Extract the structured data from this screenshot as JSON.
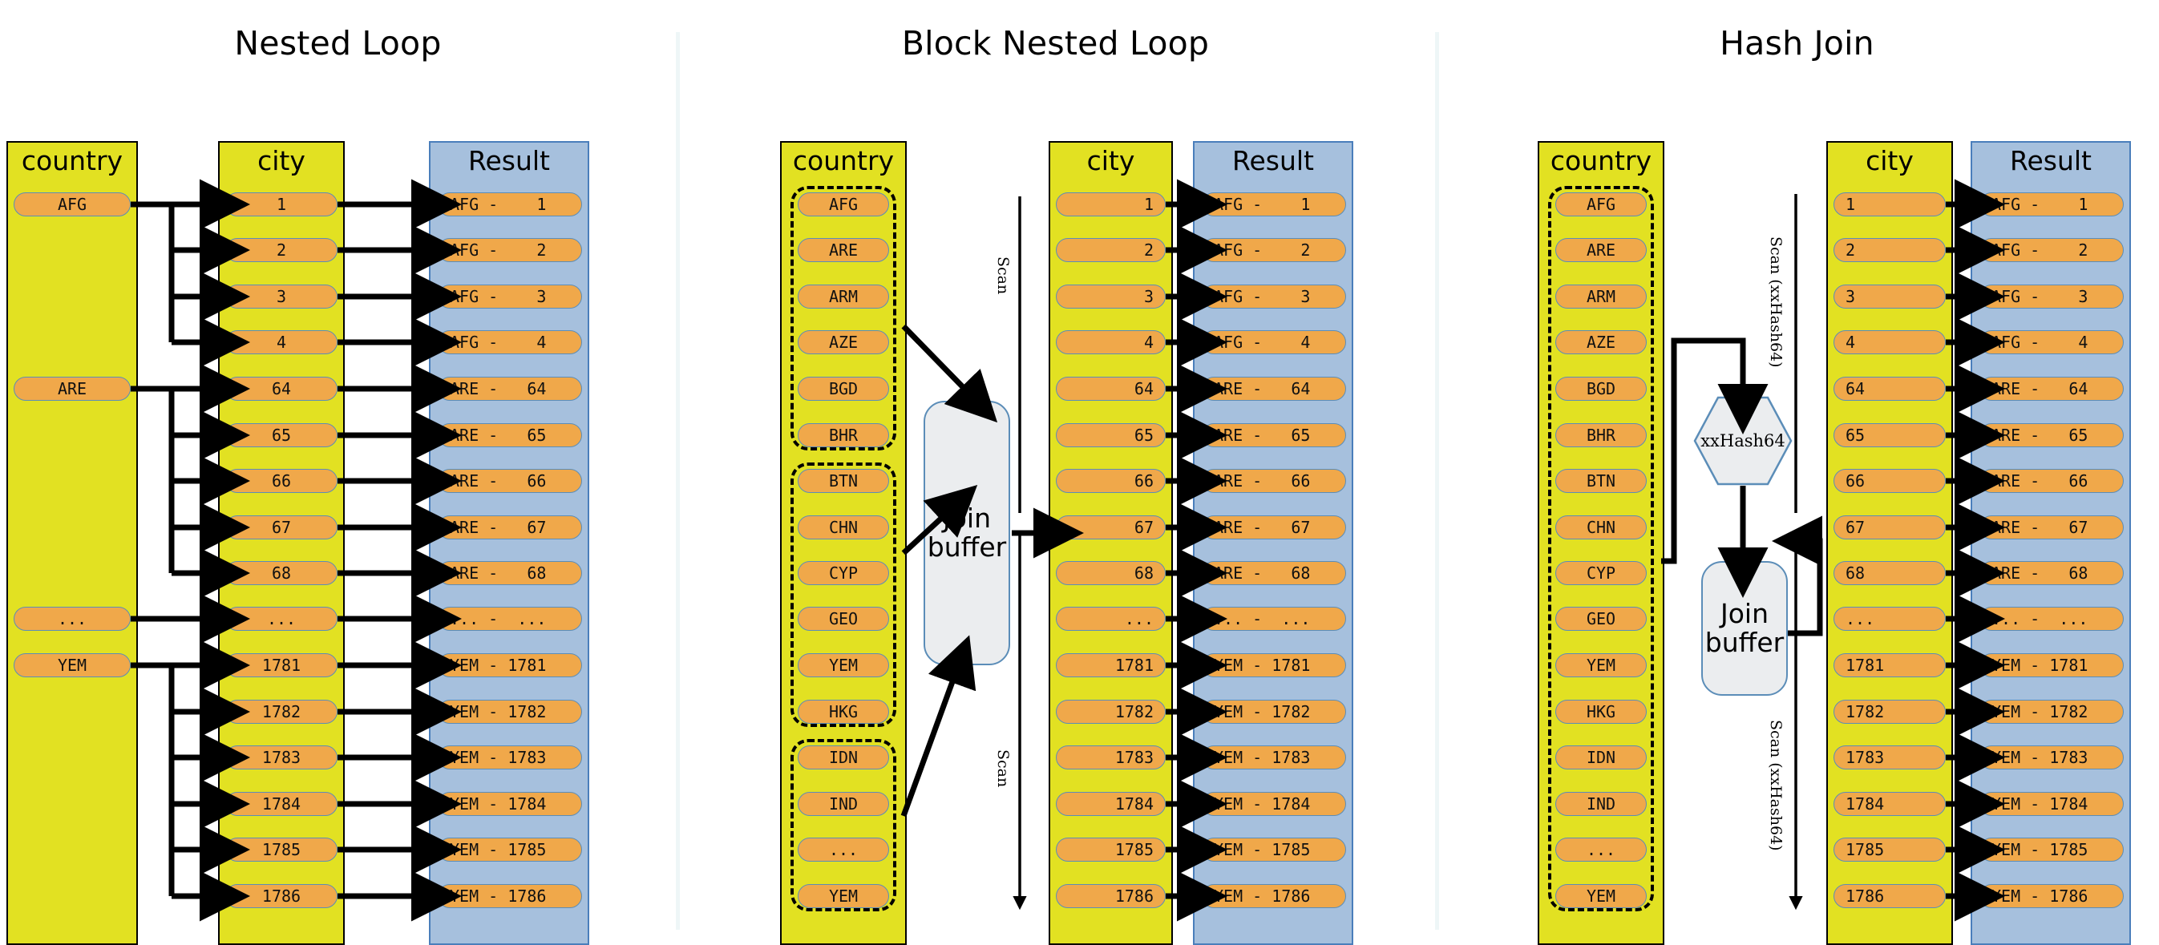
{
  "panels": [
    {
      "title": "Nested Loop",
      "columns": {
        "country": "country",
        "city": "city",
        "result": "Result"
      },
      "country_rows": [
        "AFG",
        "ARE",
        "...",
        "YEM"
      ],
      "city_rows": [
        "1",
        "2",
        "3",
        "4",
        "64",
        "65",
        "66",
        "67",
        "68",
        "...",
        "1781",
        "1782",
        "1783",
        "1784",
        "1785",
        "1786"
      ],
      "result_rows": [
        "AFG -    1",
        "AFG -    2",
        "AFG -    3",
        "AFG -    4",
        "ARE -   64",
        "ARE -   65",
        "ARE -   66",
        "ARE -   67",
        "ARE -   68",
        "... -  ...",
        "YEM - 1781",
        "YEM - 1782",
        "YEM - 1783",
        "YEM - 1784",
        "YEM - 1785",
        "YEM - 1786"
      ]
    },
    {
      "title": "Block Nested Loop",
      "columns": {
        "country": "country",
        "city": "city",
        "result": "Result"
      },
      "country_rows": [
        "AFG",
        "ARE",
        "ARM",
        "AZE",
        "BGD",
        "BHR",
        "BTN",
        "CHN",
        "CYP",
        "GEO",
        "YEM",
        "HKG",
        "IDN",
        "IND",
        "...",
        "YEM"
      ],
      "country_blocks": [
        [
          0,
          5
        ],
        [
          6,
          11
        ],
        [
          12,
          15
        ]
      ],
      "city_rows": [
        "1",
        "2",
        "3",
        "4",
        "64",
        "65",
        "66",
        "67",
        "68",
        "...",
        "1781",
        "1782",
        "1783",
        "1784",
        "1785",
        "1786"
      ],
      "result_rows": [
        "AFG -    1",
        "AFG -    2",
        "AFG -    3",
        "AFG -    4",
        "ARE -   64",
        "ARE -   65",
        "ARE -   66",
        "ARE -   67",
        "ARE -   68",
        "... -  ...",
        "YEM - 1781",
        "YEM - 1782",
        "YEM - 1783",
        "YEM - 1784",
        "YEM - 1785",
        "YEM - 1786"
      ],
      "join_buffer": {
        "line1": "Join",
        "line2": "buffer"
      },
      "scan_top_label": "Scan",
      "scan_bottom_label": "Scan"
    },
    {
      "title": "Hash Join",
      "columns": {
        "country": "country",
        "city": "city",
        "result": "Result"
      },
      "country_rows": [
        "AFG",
        "ARE",
        "ARM",
        "AZE",
        "BGD",
        "BHR",
        "BTN",
        "CHN",
        "CYP",
        "GEO",
        "YEM",
        "HKG",
        "IDN",
        "IND",
        "...",
        "YEM"
      ],
      "country_blocks": [
        [
          0,
          15
        ]
      ],
      "city_rows": [
        "1",
        "2",
        "3",
        "4",
        "64",
        "65",
        "66",
        "67",
        "68",
        "...",
        "1781",
        "1782",
        "1783",
        "1784",
        "1785",
        "1786"
      ],
      "result_rows": [
        "AFG -    1",
        "AFG -    2",
        "AFG -    3",
        "AFG -    4",
        "ARE -   64",
        "ARE -   65",
        "ARE -   66",
        "ARE -   67",
        "ARE -   68",
        "... -  ...",
        "YEM - 1781",
        "YEM - 1782",
        "YEM - 1783",
        "YEM - 1784",
        "YEM - 1785",
        "YEM - 1786"
      ],
      "hash_node": "xxHash64",
      "join_buffer": {
        "line1": "Join",
        "line2": "buffer"
      },
      "scan_top_label": "Scan (xxHash64)",
      "scan_bottom_label": "Scan (xxHash64)"
    }
  ],
  "colors": {
    "table_yellow": "#e2e122",
    "result_blue": "#a6c0dd",
    "row_orange": "#f0a84a",
    "row_border": "#5b8db8",
    "buffer_gray": "#ebedef",
    "divider": "#eef6f7",
    "edge_black": "#000000"
  }
}
